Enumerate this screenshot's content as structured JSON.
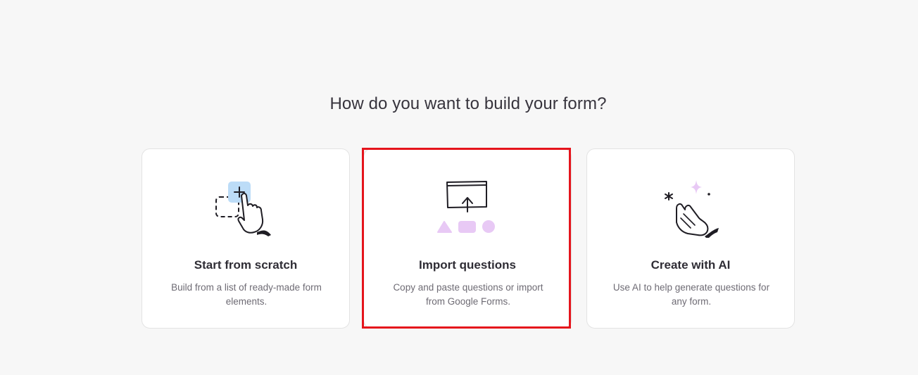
{
  "heading": "How do you want to build your form?",
  "options": [
    {
      "title": "Start from scratch",
      "description": "Build from a list of ready-made form elements.",
      "icon": "hand-add-block-icon"
    },
    {
      "title": "Import questions",
      "description": "Copy and paste questions or import from Google Forms.",
      "icon": "import-upload-icon"
    },
    {
      "title": "Create with AI",
      "description": "Use AI to help generate questions for any form.",
      "icon": "ai-magic-hand-icon"
    }
  ],
  "colors": {
    "background": "#f7f7f7",
    "card": "#ffffff",
    "accent_blue": "#bcdcf7",
    "accent_purple": "#e8c9f5",
    "highlight": "#e5141c"
  }
}
